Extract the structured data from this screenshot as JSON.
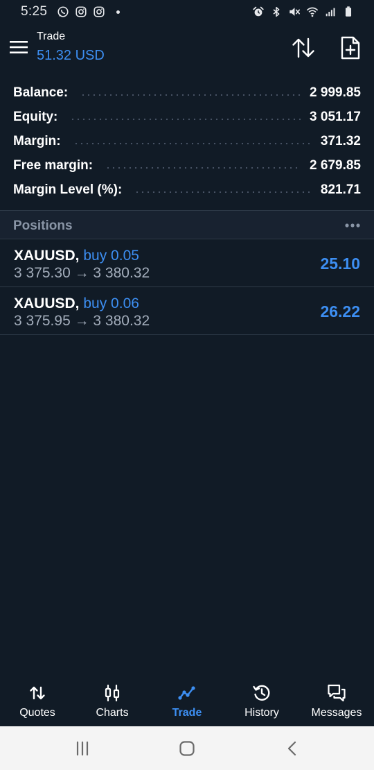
{
  "status_bar": {
    "time": "5:25",
    "left_icons": [
      "whatsapp-icon",
      "instagram-icon",
      "instagram-icon",
      "notification-dot-icon"
    ],
    "right_icons": [
      "alarm-icon",
      "bluetooth-icon",
      "mute-icon",
      "wifi-icon",
      "signal-icon",
      "battery-icon"
    ]
  },
  "app_bar": {
    "title": "Trade",
    "subtitle": "51.32 USD",
    "icons": [
      "menu-icon",
      "sort-icon",
      "new-order-icon"
    ]
  },
  "summary": [
    {
      "label": "Balance:",
      "value": "2 999.85"
    },
    {
      "label": "Equity:",
      "value": "3 051.17"
    },
    {
      "label": "Margin:",
      "value": "371.32"
    },
    {
      "label": "Free margin:",
      "value": "2 679.85"
    },
    {
      "label": "Margin Level (%):",
      "value": "821.71"
    }
  ],
  "positions": {
    "title": "Positions",
    "items": [
      {
        "symbol": "XAUUSD,",
        "side": "buy 0.05",
        "prices": "3 375.30 → 3 380.32",
        "profit": "25.10"
      },
      {
        "symbol": "XAUUSD,",
        "side": "buy 0.06",
        "prices": "3 375.95 → 3 380.32",
        "profit": "26.22"
      }
    ]
  },
  "bottom_nav": [
    {
      "label": "Quotes",
      "icon": "quotes-icon"
    },
    {
      "label": "Charts",
      "icon": "charts-icon"
    },
    {
      "label": "Trade",
      "icon": "trade-icon",
      "active": true
    },
    {
      "label": "History",
      "icon": "history-icon"
    },
    {
      "label": "Messages",
      "icon": "messages-icon"
    }
  ],
  "colors": {
    "background": "#111b26",
    "accent": "#3d8ff3",
    "muted_text": "#a3adbb",
    "section_header": "#182230",
    "system_nav": "#f4f4f4"
  }
}
